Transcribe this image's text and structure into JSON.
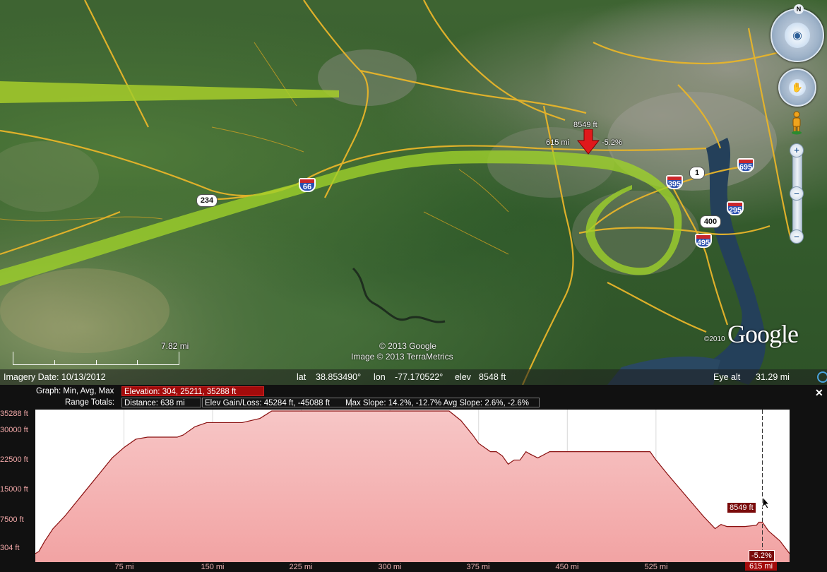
{
  "map": {
    "shields": {
      "i66": "66",
      "i395": "395",
      "i695": "695",
      "i295": "295",
      "i495": "495",
      "us1": "1",
      "rt234": "234",
      "rt400": "400"
    },
    "cursor_popup": {
      "elevation": "8549 ft",
      "distance": "615 mi",
      "slope": "-5.2%"
    },
    "scale_label": "7.82 mi",
    "copyright_1": "© 2013 Google",
    "copyright_2": "Image © 2013 TerraMetrics",
    "logo_year": "©2010",
    "logo_text": "Google",
    "north_label": "N",
    "icons": [
      "look-ring-icon",
      "move-ring-icon",
      "pegman-icon",
      "zoom-in-icon",
      "zoom-out-icon",
      "red-down-arrow-icon"
    ]
  },
  "status": {
    "imagery_date": "Imagery Date: 10/13/2012",
    "lat_label": "lat",
    "lat_value": "38.853490°",
    "lon_label": "lon",
    "lon_value": "-77.170522°",
    "elev_label": "elev",
    "elev_value": "8548 ft",
    "eye_alt_label": "Eye alt",
    "eye_alt_value": "31.29 mi"
  },
  "profile": {
    "graph_label": "Graph: Min, Avg, Max",
    "graph_value": "Elevation: 304, 25211, 35288 ft",
    "range_label": "Range Totals:",
    "distance": "Distance: 638 mi",
    "gain_loss": "Elev Gain/Loss: 45284 ft, -45088 ft",
    "slope": "Max Slope: 14.2%, -12.7%   Avg Slope: 2.6%, -2.6%",
    "close": "✕",
    "hover_elevation": "8549 ft",
    "hover_slope": "-5.2%",
    "hover_distance": "615 mi",
    "accent": "#a30b0b"
  },
  "chart_data": {
    "type": "area",
    "title": "",
    "xlabel": "",
    "ylabel": "",
    "y_ticks": [
      "35288 ft",
      "30000 ft",
      "22500 ft",
      "15000 ft",
      "7500 ft",
      "304 ft"
    ],
    "x_ticks": [
      "75 mi",
      "150 mi",
      "225 mi",
      "300 mi",
      "375 mi",
      "450 mi",
      "525 mi",
      "615 mi"
    ],
    "ylim": [
      304,
      35288
    ],
    "xlim": [
      0,
      638
    ],
    "series": [
      {
        "x": [
          0,
          3,
          8,
          15,
          25,
          35,
          45,
          55,
          65,
          75,
          85,
          95,
          105,
          115,
          120,
          125,
          135,
          145,
          150,
          160,
          175,
          190,
          200,
          205,
          210,
          225,
          250,
          300,
          340,
          350,
          360,
          370,
          375,
          385,
          390,
          395,
          400,
          405,
          410,
          415,
          418,
          425,
          435,
          440,
          450,
          500,
          520,
          525,
          535,
          550,
          565,
          575,
          580,
          585,
          590,
          600,
          610,
          612,
          615,
          620,
          630,
          638
        ],
        "y": [
          1000,
          1500,
          4000,
          7000,
          10000,
          13500,
          17000,
          20500,
          24000,
          26500,
          28500,
          29000,
          29000,
          29000,
          29000,
          29500,
          31500,
          32500,
          32500,
          32500,
          32500,
          33500,
          35288,
          35288,
          35288,
          35288,
          35288,
          35288,
          35288,
          35288,
          33000,
          29500,
          27500,
          25500,
          25500,
          24500,
          22500,
          23500,
          23500,
          25500,
          25000,
          24000,
          25500,
          25500,
          25500,
          25500,
          25500,
          23500,
          20000,
          15000,
          10000,
          7000,
          8000,
          7500,
          7500,
          7500,
          7800,
          8549,
          8549,
          6500,
          4000,
          1000
        ]
      }
    ],
    "grid": true
  }
}
